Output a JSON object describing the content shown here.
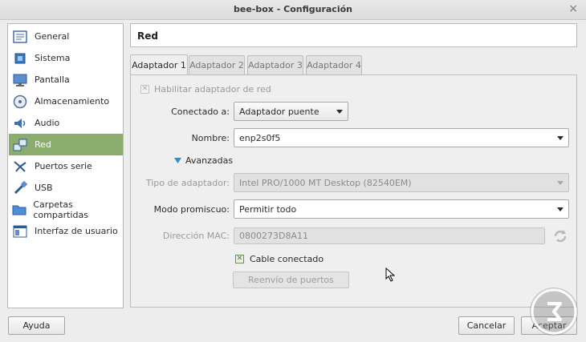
{
  "window": {
    "title": "bee-box - Configuración",
    "close_glyph": "×"
  },
  "sidebar": {
    "items": [
      {
        "label": "General",
        "icon": "general-icon"
      },
      {
        "label": "Sistema",
        "icon": "system-chip-icon"
      },
      {
        "label": "Pantalla",
        "icon": "display-monitor-icon"
      },
      {
        "label": "Almacenamiento",
        "icon": "storage-disk-icon"
      },
      {
        "label": "Audio",
        "icon": "speaker-icon"
      },
      {
        "label": "Red",
        "icon": "network-icon",
        "selected": true
      },
      {
        "label": "Puertos serie",
        "icon": "serial-port-icon"
      },
      {
        "label": "USB",
        "icon": "usb-icon"
      },
      {
        "label": "Carpetas compartidas",
        "icon": "folder-icon"
      },
      {
        "label": "Interfaz de usuario",
        "icon": "ui-window-icon"
      }
    ]
  },
  "section": {
    "title": "Red"
  },
  "tabs": [
    {
      "label": "Adaptador 1",
      "active": true
    },
    {
      "label": "Adaptador 2",
      "active": false
    },
    {
      "label": "Adaptador 3",
      "active": false
    },
    {
      "label": "Adaptador 4",
      "active": false
    }
  ],
  "form": {
    "enable_adapter": {
      "label": "Habilitar adaptador de red",
      "checked": true,
      "enabled": false
    },
    "attached_to": {
      "label": "Conectado a:",
      "value": "Adaptador puente"
    },
    "name": {
      "label": "Nombre:",
      "value": "enp2s0f5"
    },
    "advanced": {
      "label": "Avanzadas"
    },
    "adapter_type": {
      "label": "Tipo de adaptador:",
      "value": "Intel PRO/1000 MT Desktop (82540EM)"
    },
    "promiscuous": {
      "label": "Modo promiscuo:",
      "value": "Permitir todo"
    },
    "mac": {
      "label": "Dirección MAC:",
      "value": "0800273D8A11"
    },
    "cable_connected": {
      "label": "Cable conectado",
      "checked": true
    },
    "port_forwarding": {
      "label": "Reenvío de puertos"
    }
  },
  "footer": {
    "help": "Ayuda",
    "cancel": "Cancelar",
    "accept": "Aceptar"
  },
  "colors": {
    "selection": "#8aad6e",
    "accent": "#2a8fd6"
  }
}
